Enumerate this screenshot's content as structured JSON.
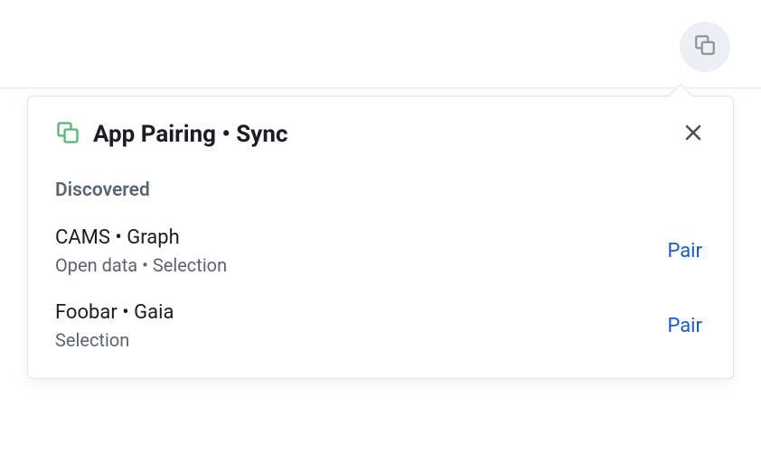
{
  "popover": {
    "title": "App Pairing • Sync",
    "section_label": "Discovered",
    "devices": [
      {
        "name": "CAMS • Graph",
        "meta": "Open data  •  Selection",
        "action": "Pair"
      },
      {
        "name": "Foobar • Gaia",
        "meta": "Selection",
        "action": "Pair"
      }
    ]
  },
  "icons": {
    "pair": "pair-icon",
    "close": "close-icon"
  }
}
